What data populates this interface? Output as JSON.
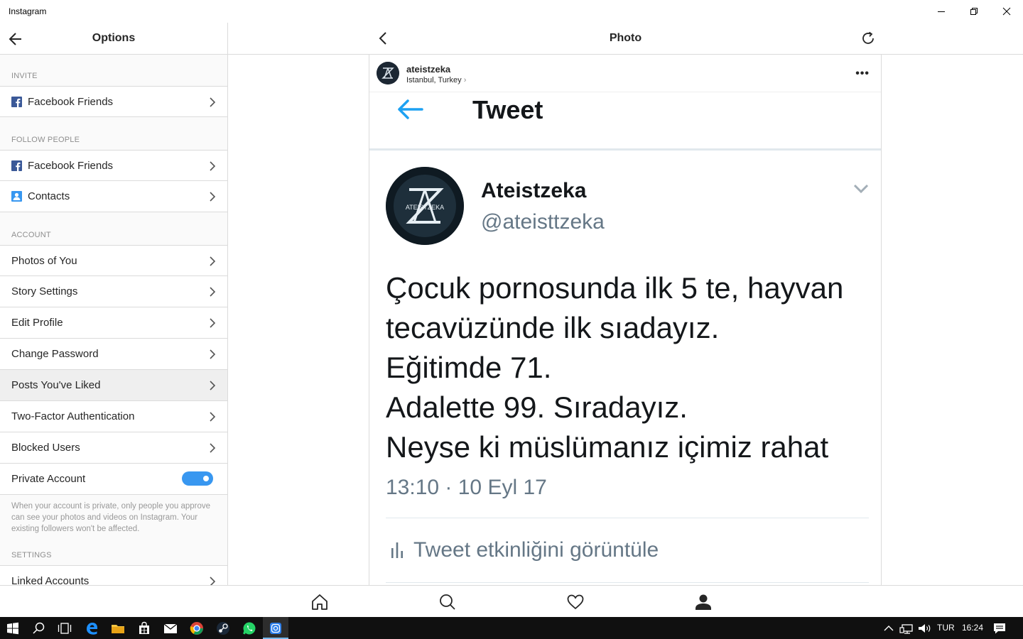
{
  "window": {
    "title": "Instagram"
  },
  "options_panel": {
    "title": "Options",
    "sections": {
      "invite": "INVITE",
      "follow_people": "FOLLOW PEOPLE",
      "account": "ACCOUNT",
      "settings": "SETTINGS"
    },
    "invite_items": [
      {
        "label": "Facebook Friends",
        "icon": "facebook-icon"
      }
    ],
    "follow_items": [
      {
        "label": "Facebook Friends",
        "icon": "facebook-icon"
      },
      {
        "label": "Contacts",
        "icon": "contacts-icon"
      }
    ],
    "account_items": [
      {
        "label": "Photos of You"
      },
      {
        "label": "Story Settings"
      },
      {
        "label": "Edit Profile"
      },
      {
        "label": "Change Password"
      },
      {
        "label": "Posts You've Liked",
        "highlighted": true
      },
      {
        "label": "Two-Factor Authentication"
      },
      {
        "label": "Blocked Users"
      }
    ],
    "private_account": {
      "label": "Private Account",
      "enabled": true,
      "note": "When your account is private, only people you approve can see your photos and videos on Instagram. Your existing followers won't be affected."
    },
    "settings_items": [
      {
        "label": "Linked Accounts"
      }
    ]
  },
  "photo_view": {
    "title": "Photo",
    "post": {
      "username": "ateistzeka",
      "location": "Istanbul, Turkey",
      "more_label": "•••"
    },
    "tweet": {
      "header_title": "Tweet",
      "display_name": "Ateistzeka",
      "handle": "@ateisttzeka",
      "text_lines": [
        "Çocuk pornosunda ilk 5 te, hayvan",
        "tecavüzünde ilk sıadayız.",
        "Eğitimde 71.",
        "Adalette 99. Sıradayız.",
        "Neyse ki müslümanız içimiz rahat"
      ],
      "timestamp": "13:10 · 10 Eyl 17",
      "activity_label": "Tweet etkinliğini görüntüle"
    }
  },
  "tabbar": {
    "tabs": [
      "home-icon",
      "search-icon",
      "heart-icon",
      "profile-icon"
    ]
  },
  "taskbar": {
    "language": "TUR",
    "time": "16:24"
  },
  "colors": {
    "accent": "#3897f0",
    "twitter_blue": "#1da1f2"
  }
}
